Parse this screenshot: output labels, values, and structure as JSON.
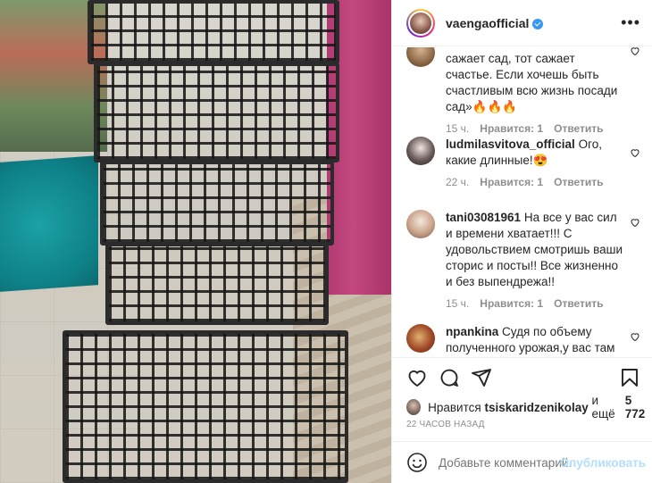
{
  "post": {
    "username": "vaengaofficial",
    "verified": true,
    "more_label": "•••"
  },
  "comments": [
    {
      "username": "",
      "text": "сажает сад, тот сажает счастье. Если хочешь быть счастливым всю жизнь посади сад»🔥🔥🔥",
      "time": "15 ч.",
      "likes": "Нравится: 1",
      "reply": "Ответить"
    },
    {
      "username": "ludmilasvitova_official",
      "text": "Ого, какие длинные!😍",
      "time": "22 ч.",
      "likes": "Нравится: 1",
      "reply": "Ответить"
    },
    {
      "username": "tani03081961",
      "text": "На все у вас сил и времени хватает!!! С удовольствием смотришь ваши сторис и посты!! Все жизненно и без выпендрежа!!",
      "time": "15 ч.",
      "likes": "Нравится: 1",
      "reply": "Ответить"
    },
    {
      "username": "npankina",
      "text": "Судя по объему полученного урожая,у вас там"
    }
  ],
  "likes_line": {
    "prefix": "Нравится",
    "user": "tsiskaridzenikolay",
    "suffix": "и ещё",
    "count": "5 772"
  },
  "timestamp": "22 часов назад",
  "add_comment": {
    "placeholder": "Добавьте комментарий...",
    "publish": "Опубликовать"
  },
  "icons": {
    "like": "heart-icon",
    "comment": "comment-icon",
    "share": "share-icon",
    "save": "bookmark-icon",
    "emoji": "emoji-icon"
  },
  "colors": {
    "verified": "#3897f0",
    "publish_disabled": "#b2dffc",
    "meta_text": "#8e8e8e"
  }
}
